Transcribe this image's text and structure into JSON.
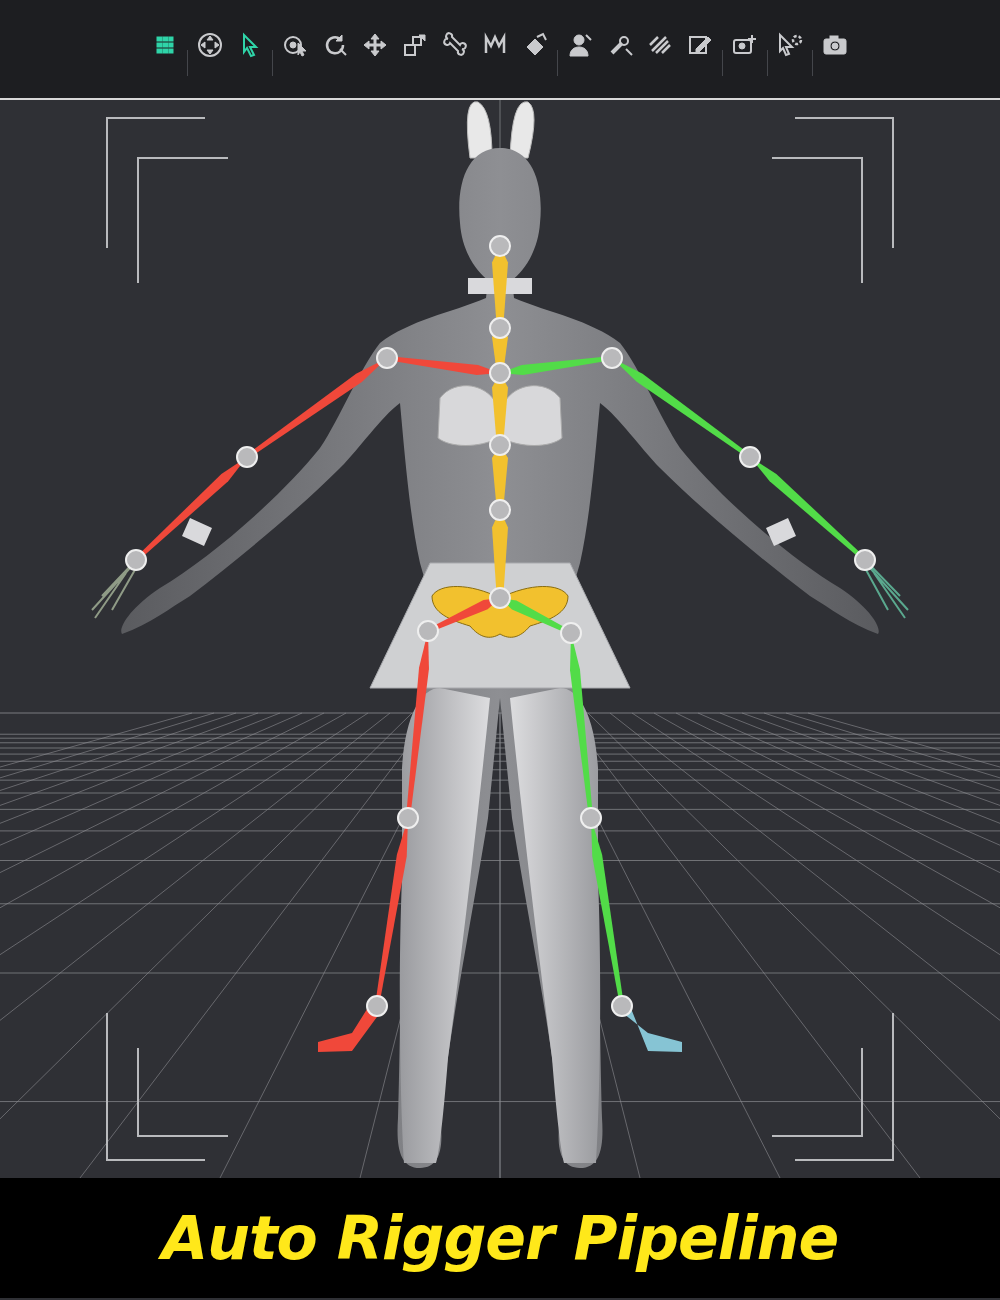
{
  "toolbar": {
    "tools": [
      {
        "selected": true
      },
      {
        "selected": false
      },
      {
        "selected": true
      },
      {
        "selected": false
      },
      {
        "selected": false
      },
      {
        "selected": false
      },
      {
        "selected": false
      },
      {
        "selected": false
      },
      {
        "selected": false
      },
      {
        "selected": false
      },
      {
        "selected": false
      },
      {
        "selected": false
      },
      {
        "selected": false
      },
      {
        "selected": false
      },
      {
        "selected": false
      },
      {
        "selected": false
      },
      {
        "selected": false
      }
    ]
  },
  "skeleton": {
    "chains": [
      {
        "name": "spine",
        "color": "#f2c12e"
      },
      {
        "name": "right-arm",
        "color": "#f0483a"
      },
      {
        "name": "left-arm",
        "color": "#52dc48"
      },
      {
        "name": "right-leg",
        "color": "#f0483a"
      },
      {
        "name": "left-leg",
        "color": "#52dc48"
      },
      {
        "name": "right-foot",
        "color": "#f0483a"
      },
      {
        "name": "left-foot",
        "color": "#86c4d4"
      }
    ]
  },
  "caption": "Auto Rigger Pipeline"
}
